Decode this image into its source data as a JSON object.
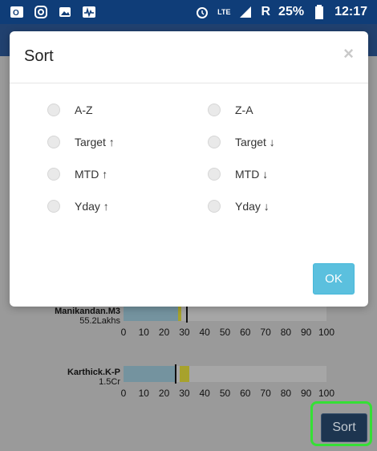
{
  "status_bar": {
    "lte": "LTE",
    "roaming": "R",
    "battery": "25%",
    "time": "12:17",
    "icons": [
      "outlook-icon",
      "instagram-icon",
      "gallery-icon",
      "pulse-icon",
      "alarm-icon",
      "signal-icon",
      "battery-icon"
    ]
  },
  "modal": {
    "title": "Sort",
    "close": "×",
    "options": [
      {
        "label": "A-Z"
      },
      {
        "label": "Z-A"
      },
      {
        "label": "Target ↑"
      },
      {
        "label": "Target ↓"
      },
      {
        "label": "MTD ↑"
      },
      {
        "label": "MTD ↓"
      },
      {
        "label": "Yday ↑"
      },
      {
        "label": "Yday ↓"
      }
    ],
    "ok_label": "OK"
  },
  "background": {
    "charts": [
      {
        "name": "Manikandan.M3",
        "value": "55.2Lakhs"
      },
      {
        "name": "Karthick.K-P",
        "value": "1.5Cr"
      }
    ],
    "ticks": [
      "0",
      "10",
      "20",
      "30",
      "40",
      "50",
      "60",
      "70",
      "80",
      "90",
      "100"
    ]
  },
  "sort_button_label": "Sort",
  "colors": {
    "status_bar": "#0f3d78",
    "overlay_gray": "#8f8f8f",
    "ok_button": "#5bc0de",
    "sort_button": "#1d3550",
    "highlight_green": "#35e035"
  }
}
